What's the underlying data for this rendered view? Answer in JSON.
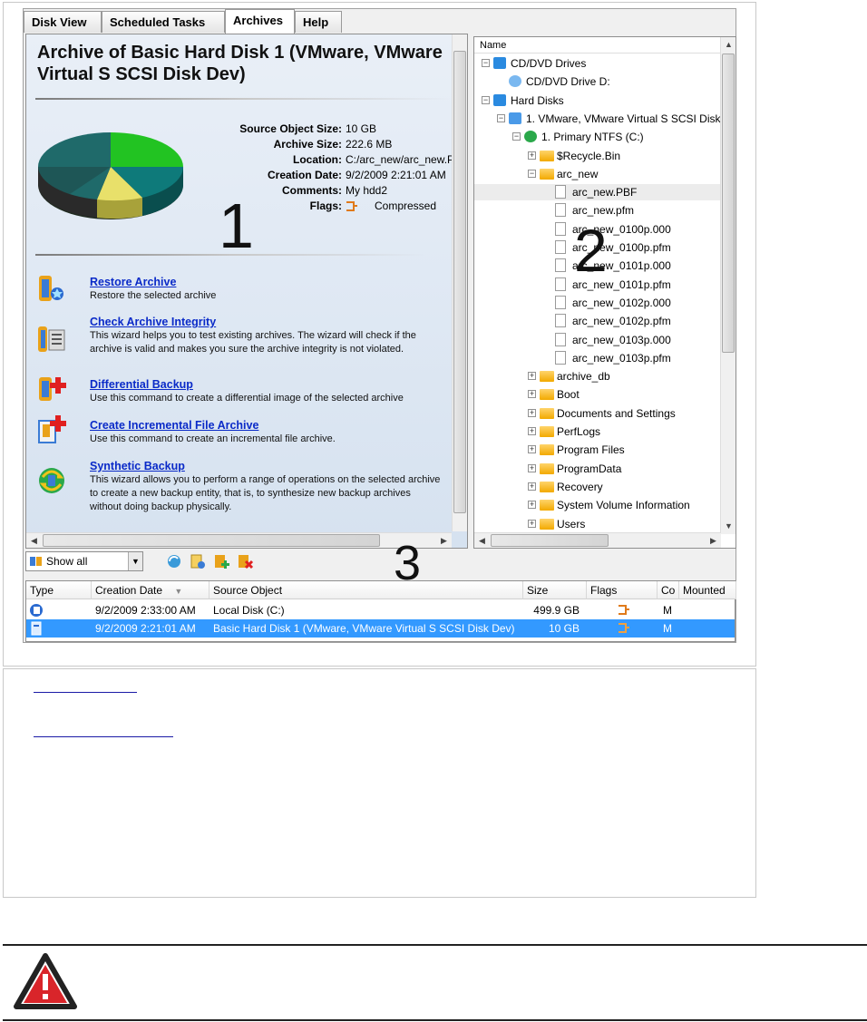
{
  "tabs": [
    "Disk View",
    "Scheduled Tasks",
    "Archives",
    "Help"
  ],
  "archive": {
    "title": "Archive of Basic Hard Disk 1 (VMware, VMware Virtual S SCSI Disk Dev)",
    "properties": [
      {
        "label": "Source Object Size:",
        "value": "10 GB"
      },
      {
        "label": "Archive Size:",
        "value": "222.6 MB"
      },
      {
        "label": "Location:",
        "value": "C:/arc_new/arc_new.P"
      },
      {
        "label": "Creation Date:",
        "value": "9/2/2009 2:21:01 AM"
      },
      {
        "label": "Comments:",
        "value": "My hdd2"
      },
      {
        "label": "Flags:",
        "value": "Compressed"
      }
    ],
    "pie_colors": [
      "#22c322",
      "#0e7a7a",
      "#e8e06a",
      "#2a8a5a"
    ]
  },
  "actions": [
    {
      "title": "Restore Archive",
      "desc": "Restore the selected archive"
    },
    {
      "title": "Check Archive Integrity",
      "desc": "This wizard helps you to test existing archives. The wizard will check if the archive is valid and makes you sure the archive integrity is not violated."
    },
    {
      "title": "Differential Backup",
      "desc": "Use this command to create a differential image of the selected archive"
    },
    {
      "title": "Create Incremental File Archive",
      "desc": "Use this command to create an incremental file archive."
    },
    {
      "title": "Synthetic Backup",
      "desc": "This wizard allows you to perform a range of operations on the selected archive to create a new backup entity, that is, to synthesize new backup archives without doing backup physically."
    }
  ],
  "tree": {
    "header": "Name",
    "nodes": [
      {
        "text": "CD/DVD Drives",
        "kind": "drive"
      },
      {
        "text": "CD/DVD Drive D:",
        "kind": "cd"
      },
      {
        "text": "Hard Disks",
        "kind": "drive"
      },
      {
        "text": "1. VMware, VMware Virtual S SCSI Disk",
        "kind": "disk"
      },
      {
        "text": "1. Primary NTFS (C:)",
        "kind": "part"
      },
      {
        "text": "$Recycle.Bin",
        "kind": "folder"
      },
      {
        "text": "arc_new",
        "kind": "folder"
      },
      {
        "text": "arc_new.PBF",
        "kind": "file"
      },
      {
        "text": "arc_new.pfm",
        "kind": "file"
      },
      {
        "text": "arc_new_0100p.000",
        "kind": "file"
      },
      {
        "text": "arc_new_0100p.pfm",
        "kind": "file"
      },
      {
        "text": "arc_new_0101p.000",
        "kind": "file"
      },
      {
        "text": "arc_new_0101p.pfm",
        "kind": "file"
      },
      {
        "text": "arc_new_0102p.000",
        "kind": "file"
      },
      {
        "text": "arc_new_0102p.pfm",
        "kind": "file"
      },
      {
        "text": "arc_new_0103p.000",
        "kind": "file"
      },
      {
        "text": "arc_new_0103p.pfm",
        "kind": "file"
      },
      {
        "text": "archive_db",
        "kind": "folder"
      },
      {
        "text": "Boot",
        "kind": "folder"
      },
      {
        "text": "Documents and Settings",
        "kind": "folder"
      },
      {
        "text": "PerfLogs",
        "kind": "folder"
      },
      {
        "text": "Program Files",
        "kind": "folder"
      },
      {
        "text": "ProgramData",
        "kind": "folder"
      },
      {
        "text": "Recovery",
        "kind": "folder"
      },
      {
        "text": "System Volume Information",
        "kind": "folder"
      },
      {
        "text": "Users",
        "kind": "folder"
      }
    ]
  },
  "callouts": [
    "1",
    "2",
    "3"
  ],
  "filter": {
    "value": "Show all"
  },
  "grid": {
    "columns": [
      "Type",
      "Creation Date",
      "Source Object",
      "Size",
      "Flags",
      "Co",
      "Mounted"
    ],
    "rows": [
      {
        "date": "9/2/2009 2:33:00 AM",
        "source": "Local Disk (C:)",
        "size": "499.9 GB",
        "co": "M",
        "selected": false
      },
      {
        "date": "9/2/2009 2:21:01 AM",
        "source": "Basic Hard Disk 1 (VMware, VMware Virtual S SCSI Disk Dev)",
        "size": "10 GB",
        "co": "M",
        "selected": true
      }
    ]
  },
  "colors": {
    "selection": "#3399ff",
    "link": "#0a2ac8",
    "warning_red": "#d9252a"
  }
}
